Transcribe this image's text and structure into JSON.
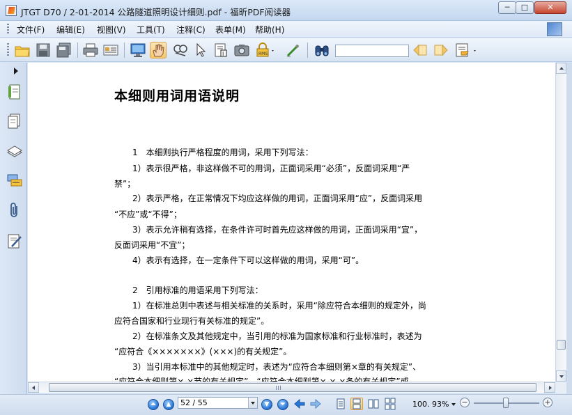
{
  "window": {
    "title": "JTGT D70 / 2-01-2014 公路隧道照明设计细则.pdf - 福昕PDF阅读器",
    "min_glyph": "─",
    "max_glyph": "□",
    "close_glyph": "✕"
  },
  "menu": {
    "items": [
      "文件(F)",
      "编辑(E)",
      "视图(V)",
      "工具(T)",
      "注释(C)",
      "表单(M)",
      "帮助(H)"
    ]
  },
  "toolbar": {
    "search_value": "",
    "icons": [
      "open-folder-icon",
      "save-icon",
      "save-all-icon",
      "print-icon",
      "properties-icon",
      "fullscreen-icon",
      "hand-tool-icon",
      "zoom-tool-icon",
      "select-arrow-icon",
      "text-select-icon",
      "snapshot-icon",
      "security-icon",
      "sign-icon",
      "find-binoculars-icon",
      "find-prev-icon",
      "find-next-icon",
      "highlight-icon"
    ]
  },
  "document": {
    "heading": "本细则用词用语说明",
    "lines": [
      "1　本细则执行严格程度的用词，采用下列写法：",
      "1）表示很严格，非这样做不可的用词，正面词采用“必须”，反面词采用“严",
      "禁”；",
      "2）表示严格，在正常情况下均应这样做的用词，正面词采用“应”，反面词采用",
      "“不应”或“不得”；",
      "3）表示允许稍有选择，在条件许可时首先应这样做的用词，正面词采用“宜”，",
      "反面词采用“不宜”；",
      "4）表示有选择，在一定条件下可以这样做的用词，采用“可”。",
      "2　引用标准的用语采用下列写法：",
      "1）在标准总则中表述与相关标准的关系时，采用“除应符合本细则的规定外，尚",
      "应符合国家和行业现行有关标准的规定”。",
      "2）在标准条文及其他规定中，当引用的标准为国家标准和行业标准时，表述为",
      "“应符合《×××××××》(×××)的有关规定”。",
      "3）当引用本标准中的其他规定时，表述为“应符合本细则第×章的有关规定”、",
      "“应符合本细则第×.×节的有关规定”、“应符合本细则第×.×.×条的有关规定”或"
    ]
  },
  "statusbar": {
    "page_value": "52 / 55",
    "zoom": "100. 93%",
    "minus": "−",
    "plus": "+"
  }
}
